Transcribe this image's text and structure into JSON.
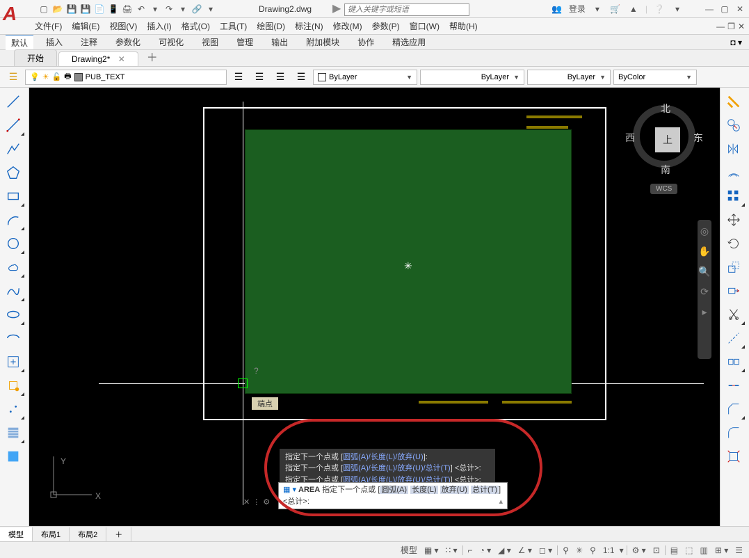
{
  "titlebar": {
    "filename": "Drawing2.dwg",
    "search_placeholder": "键入关键字或短语",
    "login_label": "登录"
  },
  "menus": [
    "文件(F)",
    "编辑(E)",
    "视图(V)",
    "插入(I)",
    "格式(O)",
    "工具(T)",
    "绘图(D)",
    "标注(N)",
    "修改(M)",
    "参数(P)",
    "窗口(W)",
    "帮助(H)"
  ],
  "ribbon_tabs": [
    "默认",
    "插入",
    "注释",
    "参数化",
    "可视化",
    "视图",
    "管理",
    "输出",
    "附加模块",
    "协作",
    "精选应用"
  ],
  "file_tabs": {
    "start": "开始",
    "active": "Drawing2*"
  },
  "props": {
    "layer": "PUB_TEXT",
    "color": "ByLayer",
    "lineweight": "ByLayer",
    "linetype": "ByLayer",
    "plotby": "ByColor"
  },
  "viewcube": {
    "n": "北",
    "s": "南",
    "e": "东",
    "w": "西",
    "top": "上",
    "wcs": "WCS"
  },
  "tooltip": "端点",
  "ucs": {
    "x": "X",
    "y": "Y"
  },
  "cmd_history": [
    {
      "pre": "指定下一个点或 [",
      "opts": "圆弧(A)/长度(L)/放弃(U)",
      "post": "]:"
    },
    {
      "pre": "指定下一个点或 [",
      "opts": "圆弧(A)/长度(L)/放弃(U)/总计(T)",
      "post": "] <总计>:"
    },
    {
      "pre": "指定下一个点或 [",
      "opts": "圆弧(A)/长度(L)/放弃(U)/总计(T)",
      "post": "] <总计>:"
    }
  ],
  "cmd_input": {
    "cmd": "AREA",
    "prompt": "指定下一个点或 [",
    "kw1": "圆弧(A)",
    "kw2": "长度(L)",
    "kw3": "放弃(U)",
    "kw4": "总计(T)",
    "suffix": "] <总计>:"
  },
  "layout_tabs": [
    "模型",
    "布局1",
    "布局2"
  ],
  "statusbar": {
    "model": "模型",
    "scale": "1:1"
  }
}
